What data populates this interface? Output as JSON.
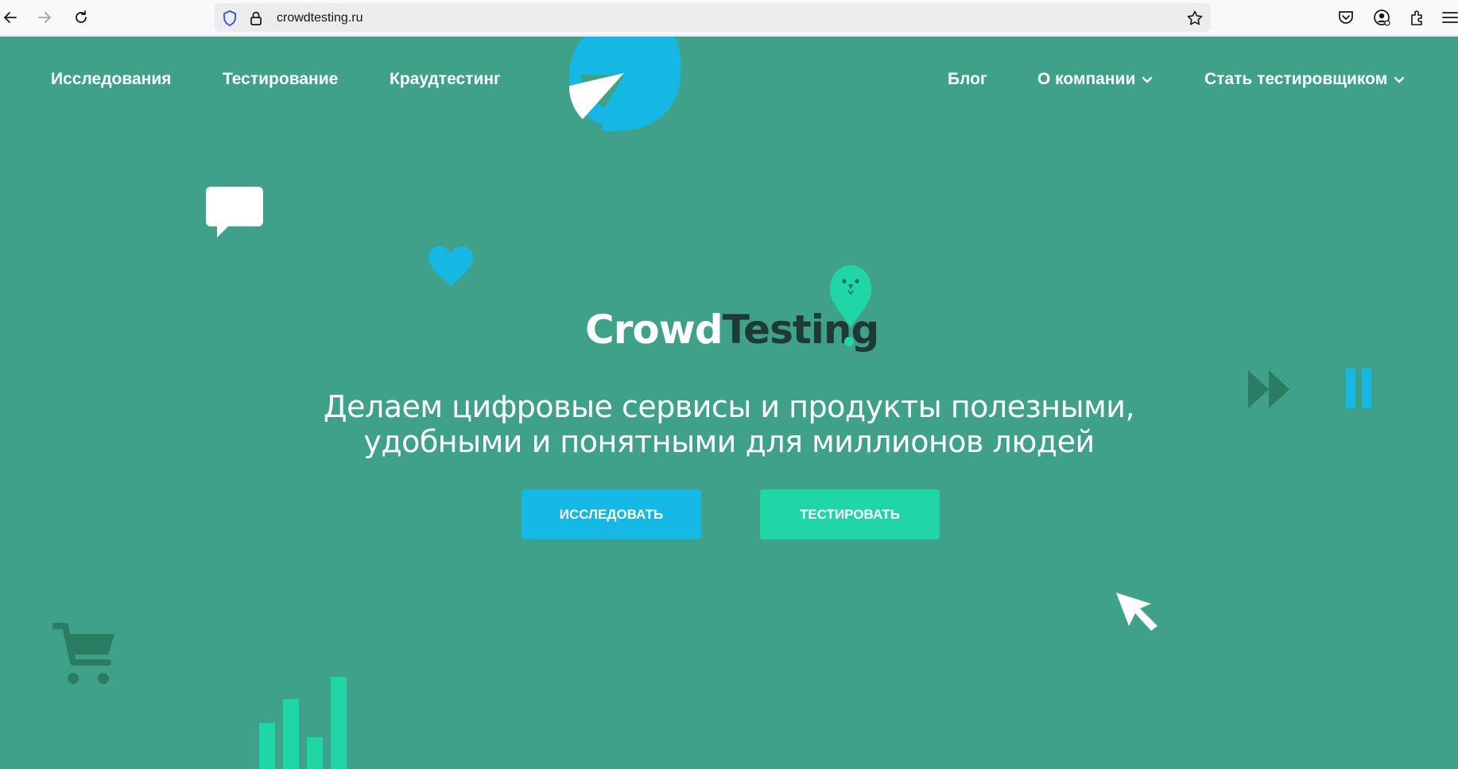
{
  "browser": {
    "url": "crowdtesting.ru",
    "icons": [
      "back-icon",
      "forward-icon",
      "reload-icon",
      "shield-icon",
      "lock-icon",
      "bookmark-star-icon",
      "pocket-icon",
      "account-icon",
      "extensions-icon",
      "menu-icon"
    ]
  },
  "nav": {
    "left": [
      "Исследования",
      "Тестирование",
      "Краудтестинг"
    ],
    "blog": "Блог",
    "company": "О компании",
    "become_tester": "Стать тестировщиком"
  },
  "hero": {
    "logo_part1": "Crowd",
    "logo_part2": "Testing",
    "tagline_line1": "Делаем цифровые сервисы и продукты полезными,",
    "tagline_line2": "удобными и понятными для миллионов людей",
    "research_button": "ИССЛЕДОВАТЬ",
    "test_button": "ТЕСТИРОВАТЬ"
  },
  "colors": {
    "background": "#3fa187",
    "blue": "#15b7e4",
    "mint": "#20d6a7",
    "dark_green": "#2a7d63",
    "logo_dark": "#1f3a36"
  }
}
